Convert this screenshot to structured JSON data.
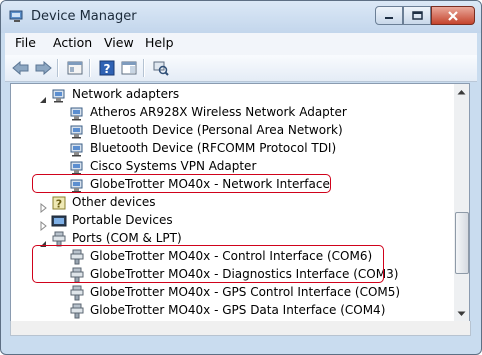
{
  "window": {
    "title": "Device Manager"
  },
  "menu": {
    "items": [
      "File",
      "Action",
      "View",
      "Help"
    ]
  },
  "toolbar": {
    "buttons": [
      "back-icon",
      "forward-icon",
      "properties-icon",
      "help-icon",
      "show-hide-icon",
      "scan-hardware-icon"
    ]
  },
  "tree": {
    "rows": [
      {
        "label": "Network adapters",
        "icon": "network-adapter-icon",
        "expanded": true
      },
      {
        "label": "Atheros AR928X Wireless Network Adapter",
        "icon": "network-adapter-icon"
      },
      {
        "label": "Bluetooth Device (Personal Area Network)",
        "icon": "network-adapter-icon"
      },
      {
        "label": "Bluetooth Device (RFCOMM Protocol TDI)",
        "icon": "network-adapter-icon"
      },
      {
        "label": "Cisco Systems VPN Adapter",
        "icon": "network-adapter-icon"
      },
      {
        "label": "GlobeTrotter MO40x - Network Interface",
        "icon": "network-adapter-icon"
      },
      {
        "label": "Other devices",
        "icon": "unknown-device-icon",
        "expanded": false
      },
      {
        "label": "Portable Devices",
        "icon": "portable-device-icon",
        "expanded": false
      },
      {
        "label": "Ports (COM & LPT)",
        "icon": "port-icon",
        "expanded": true
      },
      {
        "label": "GlobeTrotter MO40x - Control Interface (COM6)",
        "icon": "port-icon"
      },
      {
        "label": "GlobeTrotter MO40x - Diagnostics Interface (COM3)",
        "icon": "port-icon"
      },
      {
        "label": "GlobeTrotter MO40x - GPS Control Interface (COM5)",
        "icon": "port-icon"
      },
      {
        "label": "GlobeTrotter MO40x - GPS Data Interface (COM4)",
        "icon": "port-icon"
      }
    ]
  },
  "colors": {
    "highlight": "#d0021b",
    "frame": "#c9dcef",
    "close": "#c5442d"
  }
}
